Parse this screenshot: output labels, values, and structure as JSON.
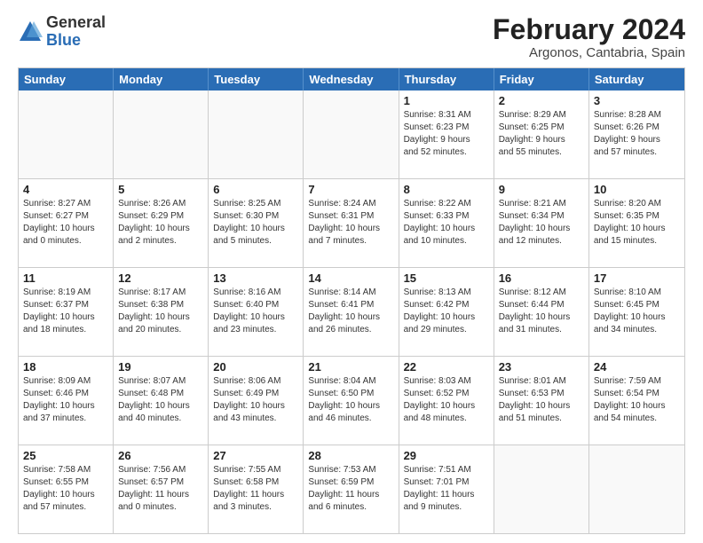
{
  "logo": {
    "general": "General",
    "blue": "Blue"
  },
  "title": "February 2024",
  "subtitle": "Argonos, Cantabria, Spain",
  "header_days": [
    "Sunday",
    "Monday",
    "Tuesday",
    "Wednesday",
    "Thursday",
    "Friday",
    "Saturday"
  ],
  "weeks": [
    [
      {
        "day": "",
        "info": ""
      },
      {
        "day": "",
        "info": ""
      },
      {
        "day": "",
        "info": ""
      },
      {
        "day": "",
        "info": ""
      },
      {
        "day": "1",
        "info": "Sunrise: 8:31 AM\nSunset: 6:23 PM\nDaylight: 9 hours\nand 52 minutes."
      },
      {
        "day": "2",
        "info": "Sunrise: 8:29 AM\nSunset: 6:25 PM\nDaylight: 9 hours\nand 55 minutes."
      },
      {
        "day": "3",
        "info": "Sunrise: 8:28 AM\nSunset: 6:26 PM\nDaylight: 9 hours\nand 57 minutes."
      }
    ],
    [
      {
        "day": "4",
        "info": "Sunrise: 8:27 AM\nSunset: 6:27 PM\nDaylight: 10 hours\nand 0 minutes."
      },
      {
        "day": "5",
        "info": "Sunrise: 8:26 AM\nSunset: 6:29 PM\nDaylight: 10 hours\nand 2 minutes."
      },
      {
        "day": "6",
        "info": "Sunrise: 8:25 AM\nSunset: 6:30 PM\nDaylight: 10 hours\nand 5 minutes."
      },
      {
        "day": "7",
        "info": "Sunrise: 8:24 AM\nSunset: 6:31 PM\nDaylight: 10 hours\nand 7 minutes."
      },
      {
        "day": "8",
        "info": "Sunrise: 8:22 AM\nSunset: 6:33 PM\nDaylight: 10 hours\nand 10 minutes."
      },
      {
        "day": "9",
        "info": "Sunrise: 8:21 AM\nSunset: 6:34 PM\nDaylight: 10 hours\nand 12 minutes."
      },
      {
        "day": "10",
        "info": "Sunrise: 8:20 AM\nSunset: 6:35 PM\nDaylight: 10 hours\nand 15 minutes."
      }
    ],
    [
      {
        "day": "11",
        "info": "Sunrise: 8:19 AM\nSunset: 6:37 PM\nDaylight: 10 hours\nand 18 minutes."
      },
      {
        "day": "12",
        "info": "Sunrise: 8:17 AM\nSunset: 6:38 PM\nDaylight: 10 hours\nand 20 minutes."
      },
      {
        "day": "13",
        "info": "Sunrise: 8:16 AM\nSunset: 6:40 PM\nDaylight: 10 hours\nand 23 minutes."
      },
      {
        "day": "14",
        "info": "Sunrise: 8:14 AM\nSunset: 6:41 PM\nDaylight: 10 hours\nand 26 minutes."
      },
      {
        "day": "15",
        "info": "Sunrise: 8:13 AM\nSunset: 6:42 PM\nDaylight: 10 hours\nand 29 minutes."
      },
      {
        "day": "16",
        "info": "Sunrise: 8:12 AM\nSunset: 6:44 PM\nDaylight: 10 hours\nand 31 minutes."
      },
      {
        "day": "17",
        "info": "Sunrise: 8:10 AM\nSunset: 6:45 PM\nDaylight: 10 hours\nand 34 minutes."
      }
    ],
    [
      {
        "day": "18",
        "info": "Sunrise: 8:09 AM\nSunset: 6:46 PM\nDaylight: 10 hours\nand 37 minutes."
      },
      {
        "day": "19",
        "info": "Sunrise: 8:07 AM\nSunset: 6:48 PM\nDaylight: 10 hours\nand 40 minutes."
      },
      {
        "day": "20",
        "info": "Sunrise: 8:06 AM\nSunset: 6:49 PM\nDaylight: 10 hours\nand 43 minutes."
      },
      {
        "day": "21",
        "info": "Sunrise: 8:04 AM\nSunset: 6:50 PM\nDaylight: 10 hours\nand 46 minutes."
      },
      {
        "day": "22",
        "info": "Sunrise: 8:03 AM\nSunset: 6:52 PM\nDaylight: 10 hours\nand 48 minutes."
      },
      {
        "day": "23",
        "info": "Sunrise: 8:01 AM\nSunset: 6:53 PM\nDaylight: 10 hours\nand 51 minutes."
      },
      {
        "day": "24",
        "info": "Sunrise: 7:59 AM\nSunset: 6:54 PM\nDaylight: 10 hours\nand 54 minutes."
      }
    ],
    [
      {
        "day": "25",
        "info": "Sunrise: 7:58 AM\nSunset: 6:55 PM\nDaylight: 10 hours\nand 57 minutes."
      },
      {
        "day": "26",
        "info": "Sunrise: 7:56 AM\nSunset: 6:57 PM\nDaylight: 11 hours\nand 0 minutes."
      },
      {
        "day": "27",
        "info": "Sunrise: 7:55 AM\nSunset: 6:58 PM\nDaylight: 11 hours\nand 3 minutes."
      },
      {
        "day": "28",
        "info": "Sunrise: 7:53 AM\nSunset: 6:59 PM\nDaylight: 11 hours\nand 6 minutes."
      },
      {
        "day": "29",
        "info": "Sunrise: 7:51 AM\nSunset: 7:01 PM\nDaylight: 11 hours\nand 9 minutes."
      },
      {
        "day": "",
        "info": ""
      },
      {
        "day": "",
        "info": ""
      }
    ]
  ]
}
